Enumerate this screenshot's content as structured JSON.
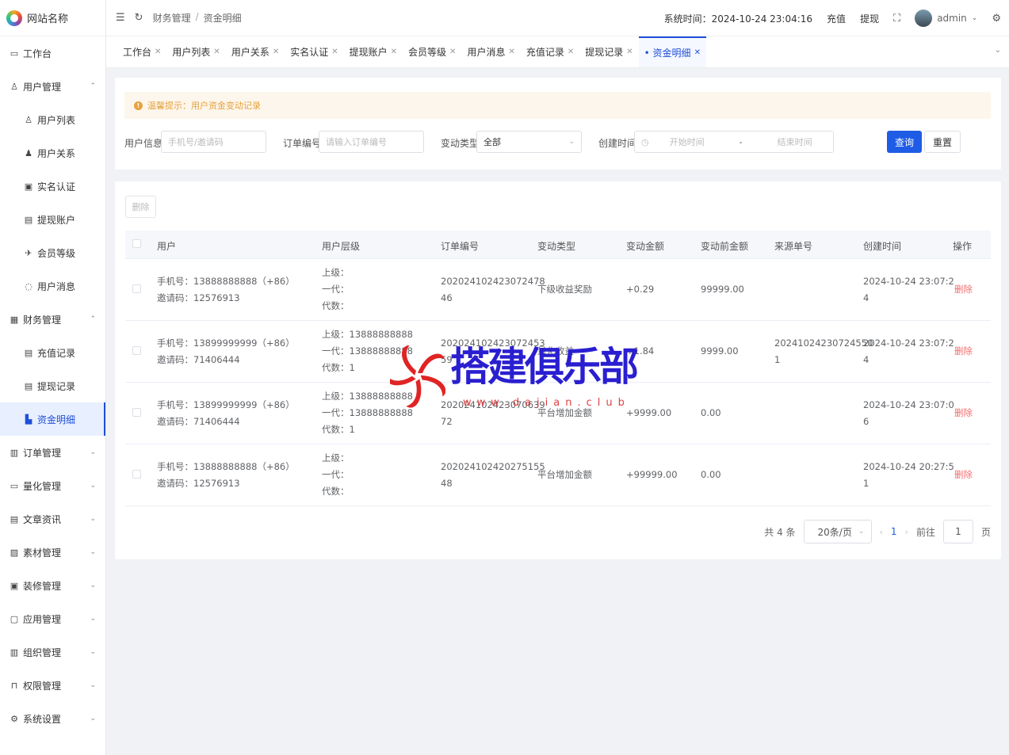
{
  "app": {
    "site_name": "网站名称"
  },
  "sidebar": {
    "items": [
      {
        "label": "工作台",
        "icon": "monitor-icon",
        "glyph": "▭",
        "level": 0,
        "arrow": ""
      },
      {
        "label": "用户管理",
        "icon": "user-icon",
        "glyph": "♙",
        "level": 0,
        "arrow": "⌃"
      },
      {
        "label": "用户列表",
        "icon": "user-list-icon",
        "glyph": "♙",
        "level": 1,
        "arrow": ""
      },
      {
        "label": "用户关系",
        "icon": "users-icon",
        "glyph": "♟",
        "level": 1,
        "arrow": ""
      },
      {
        "label": "实名认证",
        "icon": "id-card-icon",
        "glyph": "▣",
        "level": 1,
        "arrow": ""
      },
      {
        "label": "提现账户",
        "icon": "wallet-icon",
        "glyph": "▤",
        "level": 1,
        "arrow": ""
      },
      {
        "label": "会员等级",
        "icon": "rocket-icon",
        "glyph": "✈",
        "level": 1,
        "arrow": ""
      },
      {
        "label": "用户消息",
        "icon": "message-icon",
        "glyph": "◌",
        "level": 1,
        "arrow": ""
      },
      {
        "label": "财务管理",
        "icon": "chart-icon",
        "glyph": "▦",
        "level": 0,
        "arrow": "⌃"
      },
      {
        "label": "充值记录",
        "icon": "document-icon",
        "glyph": "▤",
        "level": 1,
        "arrow": ""
      },
      {
        "label": "提现记录",
        "icon": "document-icon",
        "glyph": "▤",
        "level": 1,
        "arrow": ""
      },
      {
        "label": "资金明细",
        "icon": "fund-icon",
        "glyph": "▙",
        "level": 1,
        "arrow": "",
        "active": true
      },
      {
        "label": "订单管理",
        "icon": "order-icon",
        "glyph": "▥",
        "level": 0,
        "arrow": "⌄"
      },
      {
        "label": "量化管理",
        "icon": "quant-icon",
        "glyph": "▭",
        "level": 0,
        "arrow": "⌄"
      },
      {
        "label": "文章资讯",
        "icon": "article-icon",
        "glyph": "▤",
        "level": 0,
        "arrow": "⌄"
      },
      {
        "label": "素材管理",
        "icon": "image-icon",
        "glyph": "▨",
        "level": 0,
        "arrow": "⌄"
      },
      {
        "label": "装修管理",
        "icon": "brush-icon",
        "glyph": "▣",
        "level": 0,
        "arrow": "⌄"
      },
      {
        "label": "应用管理",
        "icon": "app-icon",
        "glyph": "▢",
        "level": 0,
        "arrow": "⌄"
      },
      {
        "label": "组织管理",
        "icon": "building-icon",
        "glyph": "▥",
        "level": 0,
        "arrow": "⌄"
      },
      {
        "label": "权限管理",
        "icon": "lock-icon",
        "glyph": "⊓",
        "level": 0,
        "arrow": "⌄"
      },
      {
        "label": "系统设置",
        "icon": "gear-icon",
        "glyph": "⚙",
        "level": 0,
        "arrow": "⌄"
      }
    ]
  },
  "header": {
    "breadcrumb": [
      "财务管理",
      "资金明细"
    ],
    "system_time": "系统时间：2024-10-24 23:04:16",
    "recharge": "充值",
    "withdraw": "提现",
    "user": "admin"
  },
  "tabs": [
    {
      "label": "工作台"
    },
    {
      "label": "用户列表"
    },
    {
      "label": "用户关系"
    },
    {
      "label": "实名认证"
    },
    {
      "label": "提现账户"
    },
    {
      "label": "会员等级"
    },
    {
      "label": "用户消息"
    },
    {
      "label": "充值记录"
    },
    {
      "label": "提现记录"
    },
    {
      "label": "• 资金明细",
      "active": true
    }
  ],
  "search": {
    "tip": "温馨提示：用户资金变动记录",
    "user_info_label": "用户信息",
    "user_info_placeholder": "手机号/邀请码",
    "order_no_label": "订单编号",
    "order_no_placeholder": "请输入订单编号",
    "change_type_label": "变动类型",
    "change_type_value": "全部",
    "created_label": "创建时间",
    "start_placeholder": "开始时间",
    "range_sep": "-",
    "end_placeholder": "结束时间",
    "query": "查询",
    "reset": "重置"
  },
  "table": {
    "delete_button": "删除",
    "columns": [
      "用户",
      "用户层级",
      "订单编号",
      "变动类型",
      "变动金额",
      "变动前金额",
      "来源单号",
      "创建时间",
      "操作"
    ],
    "rows": [
      {
        "user_phone": "手机号：13888888888（+86）",
        "user_code": "邀请码：12576913",
        "level": [
          "上级：",
          "一代：",
          "代数："
        ],
        "order": [
          "202024102423072478",
          "46"
        ],
        "type": "下级收益奖励",
        "amount": "+0.29",
        "before": "99999.00",
        "source": [
          "",
          ""
        ],
        "created": [
          "2024-10-24 23:07:2",
          "4"
        ],
        "action": "删除"
      },
      {
        "user_phone": "手机号：13899999999（+86）",
        "user_code": "邀请码：71406444",
        "level": [
          "上级：13888888888",
          "一代：13888888888",
          "代数：1"
        ],
        "order": [
          "202024102423072453",
          "59"
        ],
        "type": "量化收益",
        "amount": "+1.84",
        "before": "9999.00",
        "source": [
          "20241024230724550",
          "1"
        ],
        "created": [
          "2024-10-24 23:07:2",
          "4"
        ],
        "action": "删除"
      },
      {
        "user_phone": "手机号：13899999999（+86）",
        "user_code": "邀请码：71406444",
        "level": [
          "上级：13888888888",
          "一代：13888888888",
          "代数：1"
        ],
        "order": [
          "202024102423070639",
          "72"
        ],
        "type": "平台增加金额",
        "amount": "+9999.00",
        "before": "0.00",
        "source": [
          "",
          ""
        ],
        "created": [
          "2024-10-24 23:07:0",
          "6"
        ],
        "action": "删除"
      },
      {
        "user_phone": "手机号：13888888888（+86）",
        "user_code": "邀请码：12576913",
        "level": [
          "上级：",
          "一代：",
          "代数："
        ],
        "order": [
          "202024102420275155",
          "48"
        ],
        "type": "平台增加金额",
        "amount": "+99999.00",
        "before": "0.00",
        "source": [
          "",
          ""
        ],
        "created": [
          "2024-10-24 20:27:5",
          "1"
        ],
        "action": "删除"
      }
    ]
  },
  "pagination": {
    "total": "共 4 条",
    "page_size": "20条/页",
    "current_page": "1",
    "goto_label": "前往",
    "goto_value": "1",
    "page_suffix": "页"
  },
  "watermark": {
    "text": "搭建俱乐部",
    "url": "www.dajian.club",
    "colors": {
      "text": "#2a1fd0",
      "logo": "#e02424"
    }
  },
  "colors": {
    "primary": "#1f5ce6",
    "danger": "#f56c6c",
    "warning": "#e6a23c"
  }
}
